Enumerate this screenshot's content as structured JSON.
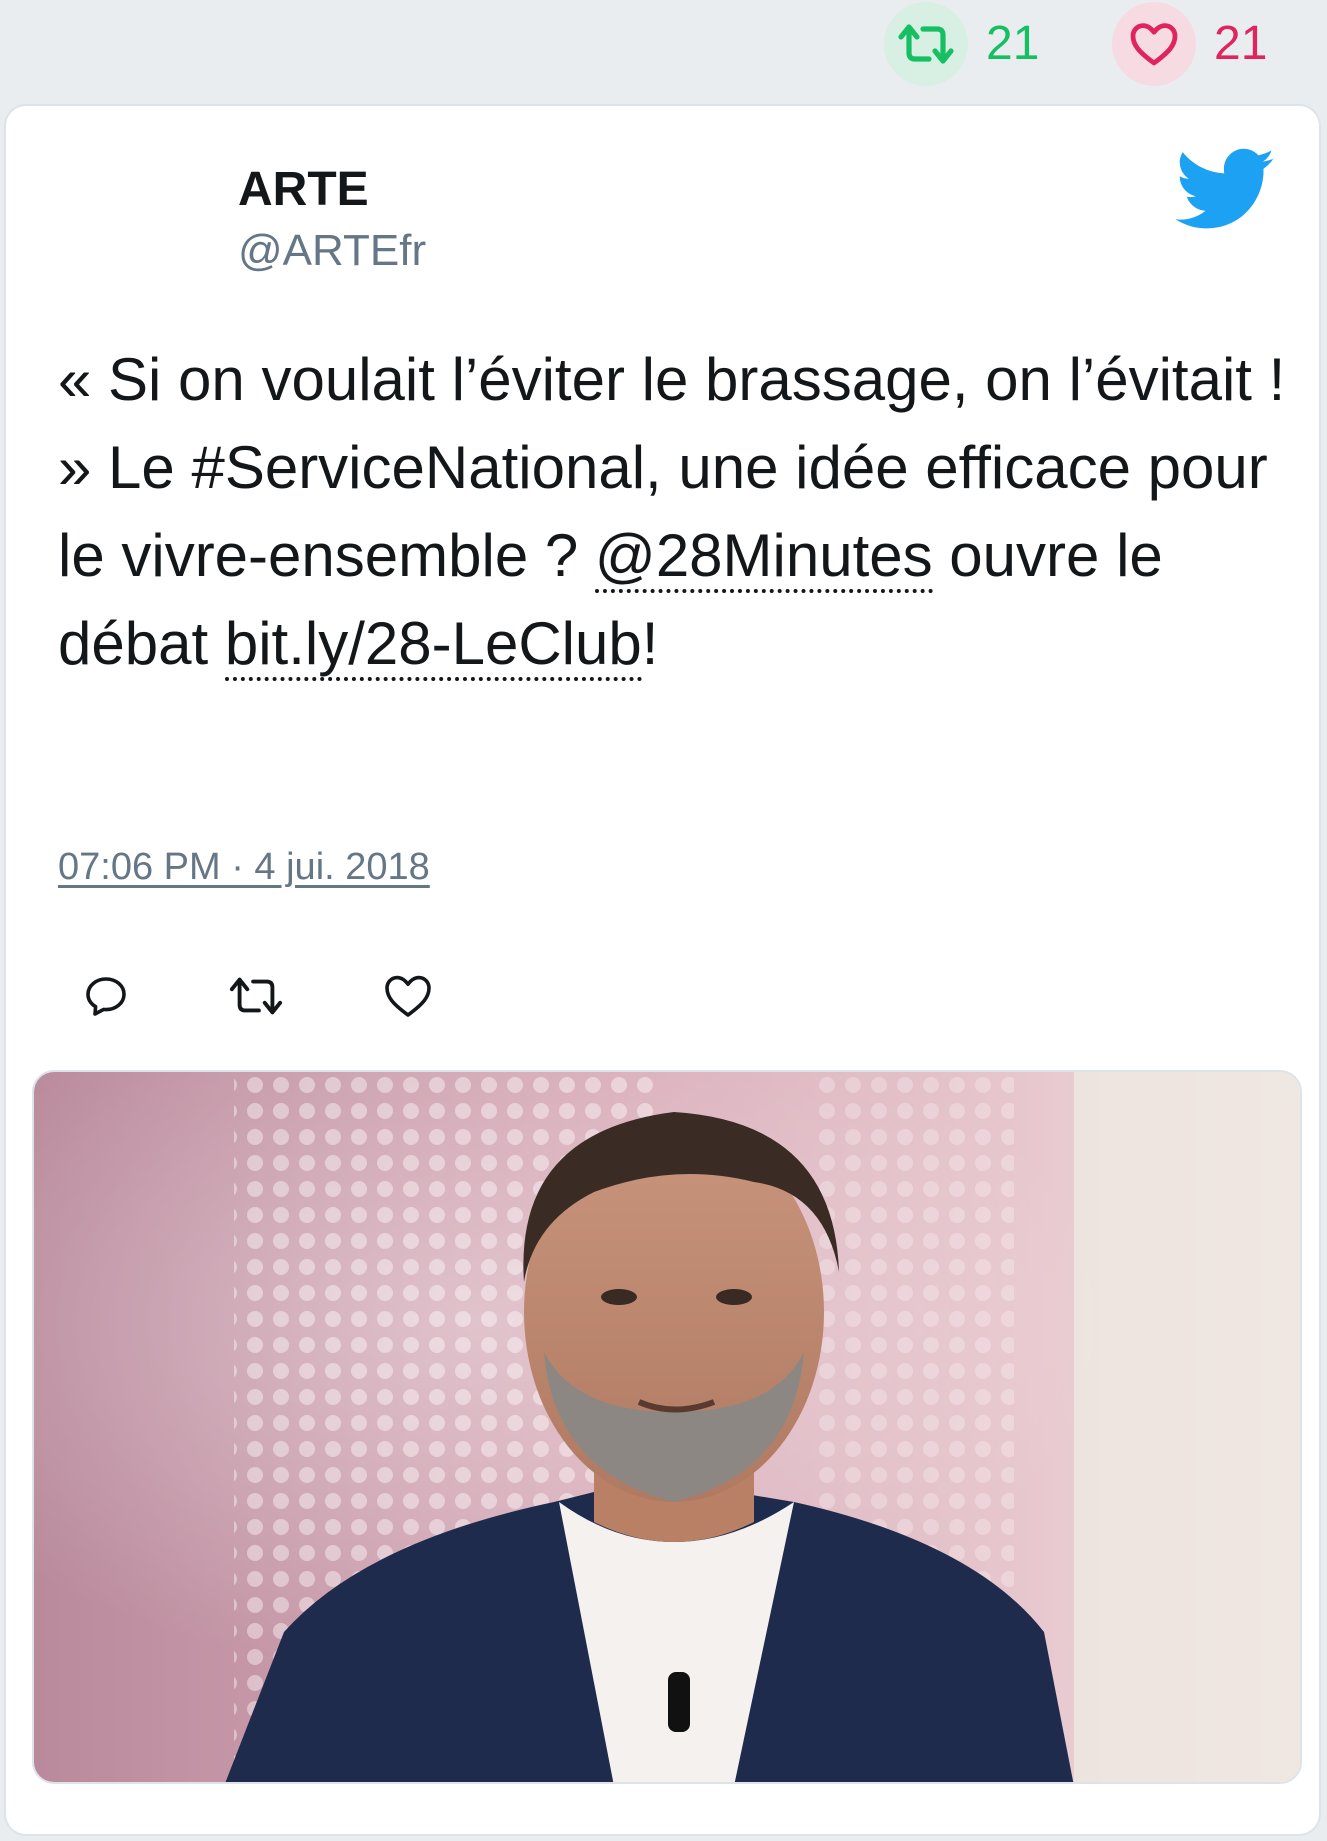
{
  "stats": {
    "retweets": "21",
    "likes": "21",
    "retweet_color": "#17bf63",
    "like_color": "#e0245e"
  },
  "author": {
    "name": "ARTE",
    "handle": "@ARTEfr"
  },
  "tweet": {
    "text_part1": "« Si on voulait l’éviter le brassage, on l’évitait ! » Le #ServiceNational, une idée efficace pour le vivre-ensemble ? ",
    "mention": "@28Minutes",
    "text_part2": " ouvre le débat ",
    "link": "bit.ly/28-LeClub",
    "text_part3": "!",
    "timestamp": "07:06 PM · 4 jui. 2018"
  },
  "icons": {
    "brand": "twitter-bird-icon",
    "reply": "reply-icon",
    "retweet": "retweet-icon",
    "like": "heart-icon"
  },
  "colors": {
    "brand_blue": "#1da1f2",
    "text": "#14171a",
    "muted": "#657786"
  }
}
